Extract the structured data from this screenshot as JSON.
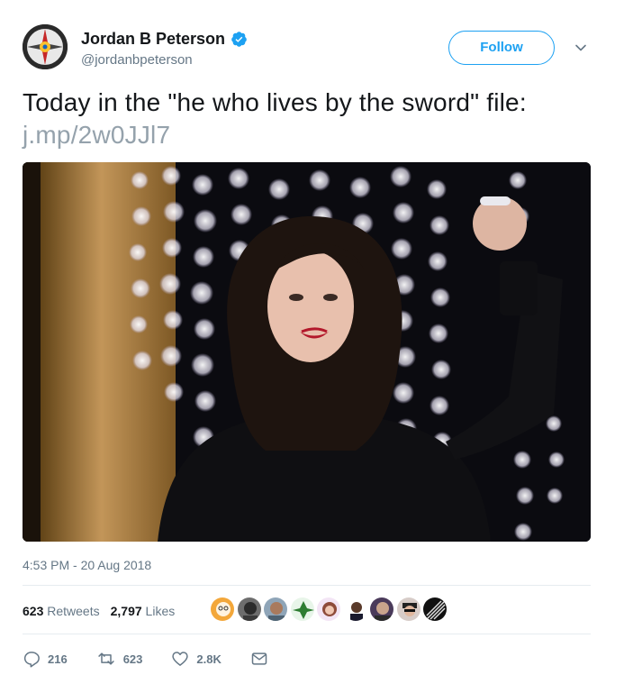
{
  "user": {
    "display_name": "Jordan B Peterson",
    "handle": "@jordanbpeterson",
    "verified_icon": "verified-badge-icon"
  },
  "header": {
    "follow_label": "Follow",
    "menu_icon": "chevron-down-icon"
  },
  "tweet": {
    "text": "Today in the \"he who lives by the sword\" file:",
    "link": "j.mp/2w0JJl7",
    "timestamp": "4:53 PM - 20 Aug 2018"
  },
  "stats": {
    "retweets_count": "623",
    "retweets_label": "Retweets",
    "likes_count": "2,797",
    "likes_label": "Likes"
  },
  "actions": {
    "reply_count": "216",
    "retweet_count": "623",
    "like_count": "2.8K"
  },
  "colors": {
    "brand_blue": "#1da1f2",
    "secondary_text": "#657786",
    "link_gray": "#95a2ac"
  }
}
